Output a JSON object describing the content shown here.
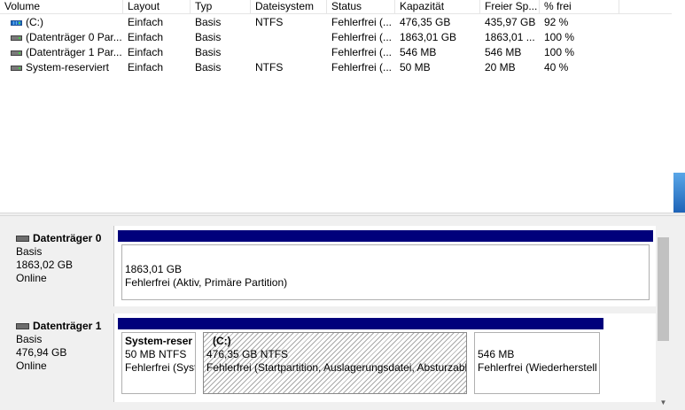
{
  "volume_list": {
    "columns": [
      "Volume",
      "Layout",
      "Typ",
      "Dateisystem",
      "Status",
      "Kapazität",
      "Freier Sp...",
      "% frei"
    ],
    "rows": [
      {
        "icon": "disk-volume-icon",
        "cells": [
          "(C:)",
          "Einfach",
          "Basis",
          "NTFS",
          "Fehlerfrei (...",
          "476,35 GB",
          "435,97 GB",
          "92 %"
        ]
      },
      {
        "icon": "disk-volume-icon",
        "cells": [
          "(Datenträger 0 Par...",
          "Einfach",
          "Basis",
          "",
          "Fehlerfrei (...",
          "1863,01 GB",
          "1863,01 ...",
          "100 %"
        ]
      },
      {
        "icon": "disk-volume-icon",
        "cells": [
          "(Datenträger 1 Par...",
          "Einfach",
          "Basis",
          "",
          "Fehlerfrei (...",
          "546 MB",
          "546 MB",
          "100 %"
        ]
      },
      {
        "icon": "disk-volume-icon",
        "cells": [
          "System-reserviert",
          "Einfach",
          "Basis",
          "NTFS",
          "Fehlerfrei (...",
          "50 MB",
          "20 MB",
          "40 %"
        ]
      }
    ]
  },
  "disks": [
    {
      "name": "Datenträger 0",
      "type": "Basis",
      "size": "1863,02 GB",
      "state": "Online",
      "partitions": [
        {
          "title": "",
          "line1": "1863,01 GB",
          "line2": "Fehlerfrei (Aktiv, Primäre Partition)",
          "hatched": false
        }
      ]
    },
    {
      "name": "Datenträger 1",
      "type": "Basis",
      "size": "476,94 GB",
      "state": "Online",
      "partitions": [
        {
          "title": "System-reser",
          "line1": "50 MB NTFS",
          "line2": "Fehlerfrei (Syst",
          "hatched": false
        },
        {
          "title": "(C:)",
          "line1": "476,35 GB NTFS",
          "line2": "Fehlerfrei (Startpartition, Auslagerungsdatei, Absturzabb",
          "hatched": true
        },
        {
          "title": "",
          "line1": "546 MB",
          "line2": "Fehlerfrei (Wiederherstell",
          "hatched": false
        }
      ]
    }
  ],
  "colors": {
    "partition_bar": "#00007b",
    "panel_bg": "#f0f0f0"
  },
  "icons": {
    "scroll_down": "▼"
  }
}
